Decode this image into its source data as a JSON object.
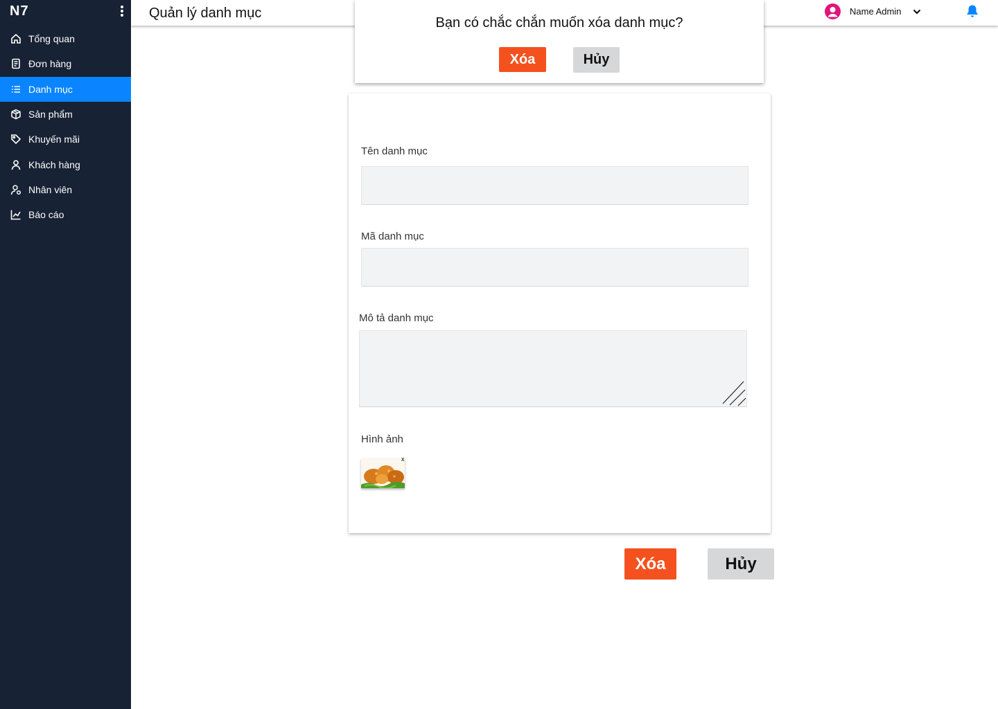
{
  "sidebar": {
    "brand": "N7",
    "items": [
      {
        "label": "Tổng quan",
        "icon": "home-icon"
      },
      {
        "label": "Đơn hàng",
        "icon": "document-icon"
      },
      {
        "label": "Danh mục",
        "icon": "list-icon",
        "active": true
      },
      {
        "label": "Sản phẩm",
        "icon": "box-icon"
      },
      {
        "label": "Khuyến mãi",
        "icon": "tag-icon"
      },
      {
        "label": "Khách hàng",
        "icon": "user-icon"
      },
      {
        "label": "Nhân viên",
        "icon": "user-badge-icon"
      },
      {
        "label": "Báo cáo",
        "icon": "chart-icon"
      }
    ]
  },
  "header": {
    "title": "Quản lý danh mục",
    "user_name": "Name Admin"
  },
  "form": {
    "name_label": "Tên danh mục",
    "code_label": "Mã danh mục",
    "description_label": "Mô tả danh mục",
    "image_label": "Hình ảnh",
    "image_remove": "x"
  },
  "actions": {
    "delete_label": "Xóa",
    "cancel_label": "Hủy"
  },
  "modal": {
    "message": "Bạn có chắc chắn muốn xóa danh mục?",
    "confirm_label": "Xóa",
    "cancel_label": "Hủy"
  },
  "colors": {
    "sidebar_bg": "#172234",
    "active_item": "#0a85ff",
    "delete_button": "#f4511e",
    "cancel_button": "#d6d7d9",
    "avatar": "#e0157a",
    "bell": "#0a85ff"
  }
}
